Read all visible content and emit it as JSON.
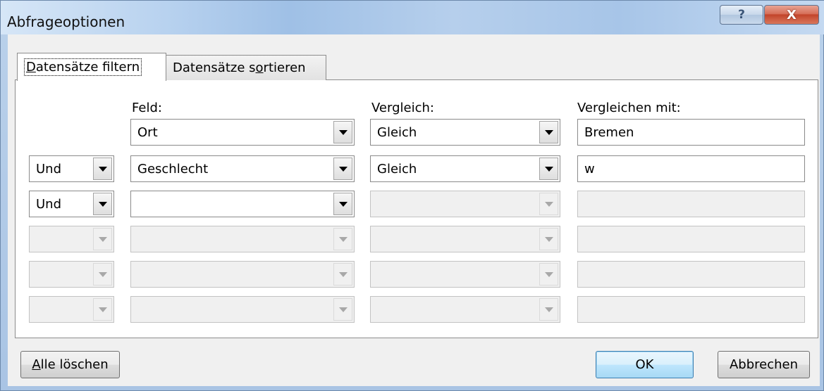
{
  "window": {
    "title": "Abfrageoptionen",
    "help_glyph": "?",
    "close_glyph": "X"
  },
  "tabs": [
    {
      "label": "Datensätze filtern",
      "mnemonic": "D",
      "rest": "atensätze filtern",
      "active": true
    },
    {
      "label": "Datensätze sortieren",
      "pre": "Datensätze s",
      "mnemonic": "o",
      "rest": "rtieren",
      "active": false
    }
  ],
  "columns": {
    "field": "Feld:",
    "comparison": "Vergleich:",
    "compare_with": "Vergleichen mit:"
  },
  "rows": [
    {
      "connector": "",
      "field": "Ort",
      "comparison": "Gleich",
      "value": "Bremen"
    },
    {
      "connector": "Und",
      "field": "Geschlecht",
      "comparison": "Gleich",
      "value": "w"
    },
    {
      "connector": "Und",
      "field": "",
      "comparison": "",
      "value": ""
    },
    {
      "connector": "",
      "field": "",
      "comparison": "",
      "value": ""
    },
    {
      "connector": "",
      "field": "",
      "comparison": "",
      "value": ""
    },
    {
      "connector": "",
      "field": "",
      "comparison": "",
      "value": ""
    }
  ],
  "buttons": {
    "clear_all": {
      "label": "Alle löschen",
      "mnemonic": "A",
      "rest": "lle löschen"
    },
    "ok": "OK",
    "cancel": "Abbrechen"
  },
  "colors": {
    "title_close": "#c2442b",
    "ok_border": "#3c7fb1",
    "panel_bg": "#ffffff",
    "dialog_bg": "#f0f0f0"
  }
}
